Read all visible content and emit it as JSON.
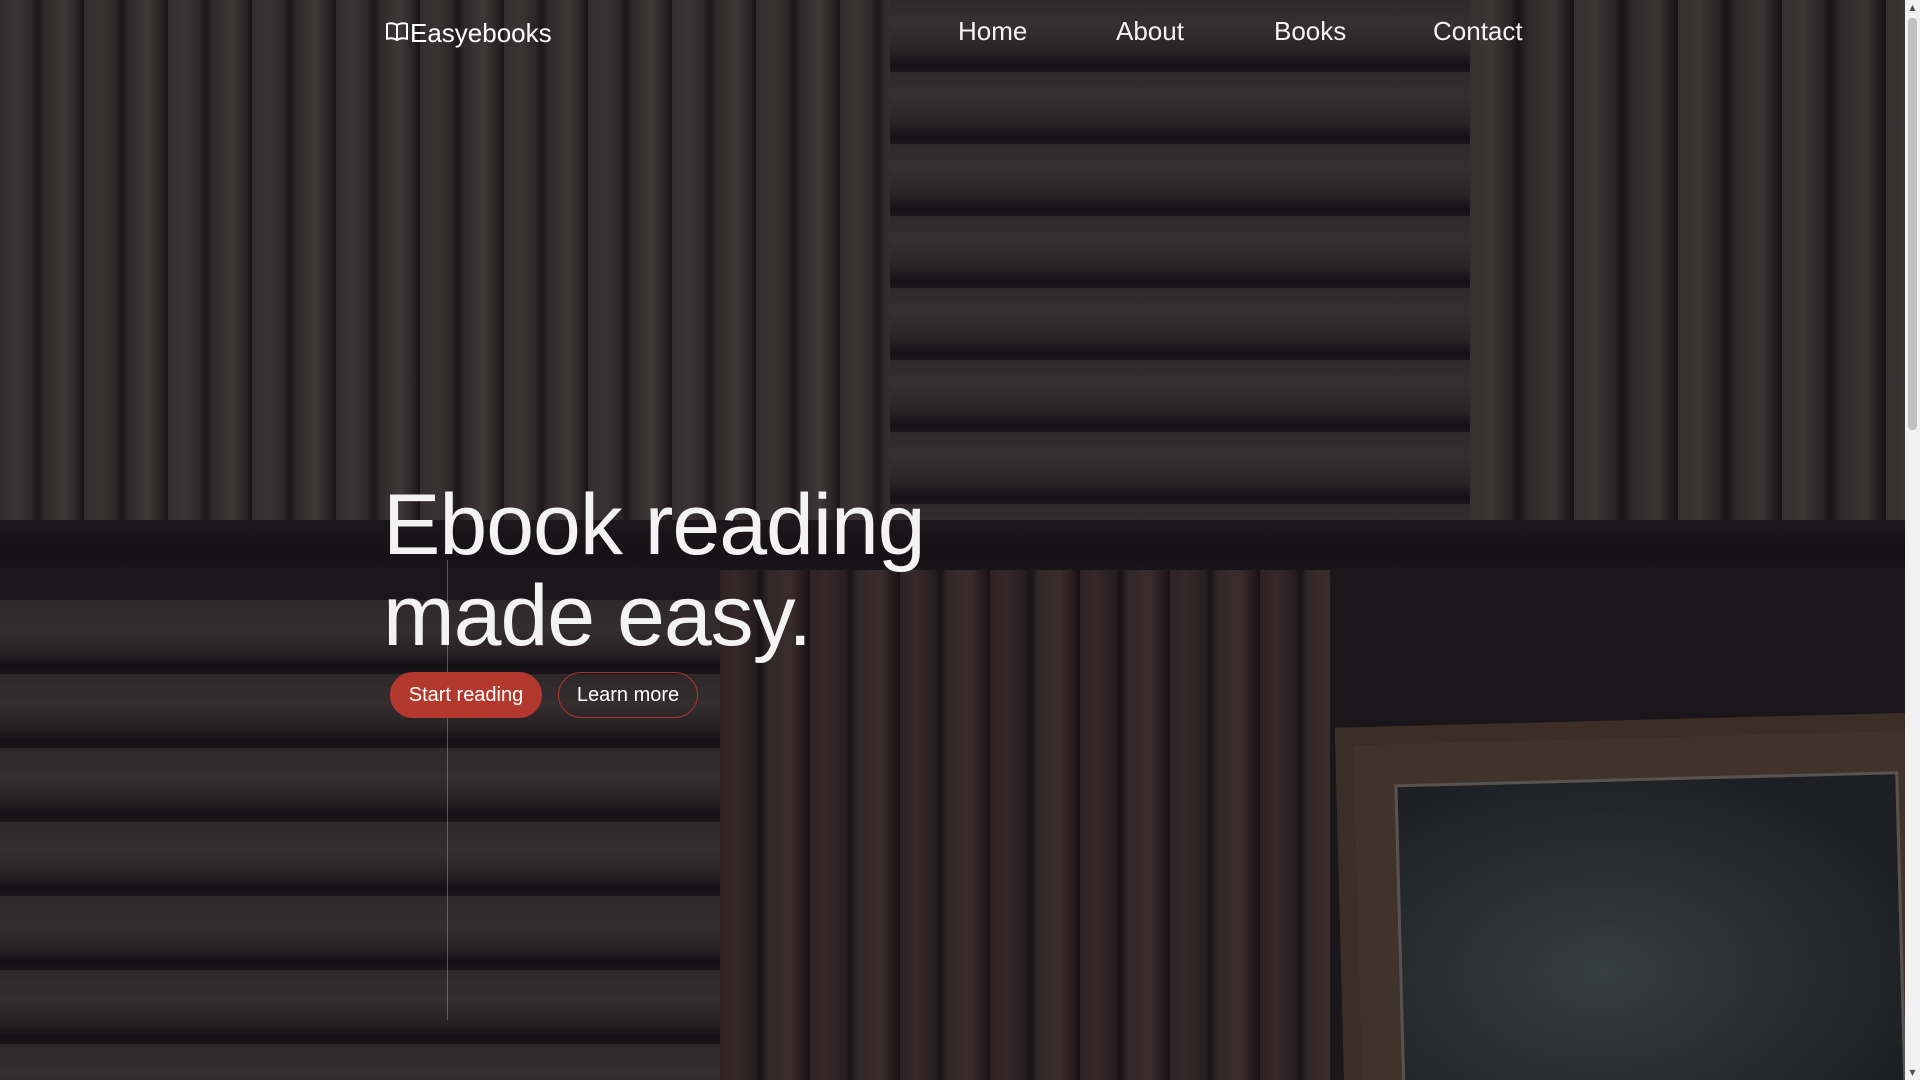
{
  "brand": {
    "name": "Easyebooks",
    "icon": "open-book-icon"
  },
  "nav": {
    "items": [
      {
        "label": "Home"
      },
      {
        "label": "About"
      },
      {
        "label": "Books"
      },
      {
        "label": "Contact"
      }
    ]
  },
  "hero": {
    "title_line1": "Ebook reading",
    "title_line2": "made easy.",
    "primary_button": "Start reading",
    "secondary_button": "Learn more",
    "background": "bookshelf-photo"
  },
  "colors": {
    "accent": "#b3382e",
    "text": "#ffffff",
    "overlay": "#140e14"
  },
  "scrollbar": {
    "up_arrow": "▲",
    "down_arrow": "▼"
  }
}
